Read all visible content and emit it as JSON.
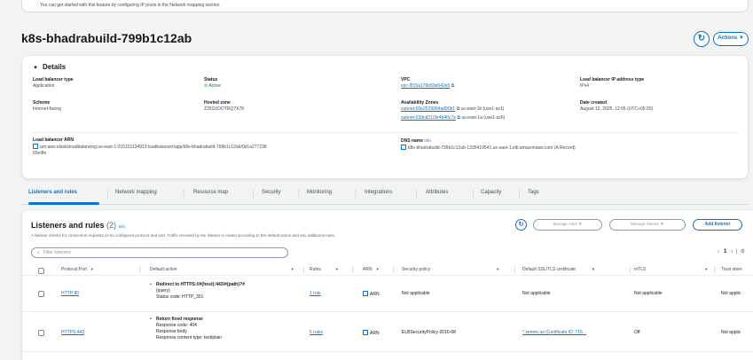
{
  "banner": {
    "text": "You can get started with this feature by configuring IP pools in the Network mapping section."
  },
  "header": {
    "title": "k8s-bhadrabuild-799b1c12ab",
    "actions_label": "Actions ▼"
  },
  "details": {
    "heading": "Details",
    "lb_type": {
      "label": "Load balancer type",
      "value": "Application"
    },
    "status": {
      "label": "Status",
      "value": "Active"
    },
    "vpc": {
      "label": "VPC",
      "value": "vpc-0f15a176b59e542e5"
    },
    "ip_type": {
      "label": "Load balancer IP address type",
      "value": "IPv4"
    },
    "scheme": {
      "label": "Scheme",
      "value": "Internet-facing"
    },
    "hosted_zone": {
      "label": "Hosted zone",
      "value": "Z35SXDOTRQ7X7K"
    },
    "az": {
      "label": "Availability Zones",
      "zones": [
        {
          "subnet": "subnet-00e2529994ad90b1",
          "zone": "us-east-1b (use1-az1)"
        },
        {
          "subnet": "subnet-02dcd212fe4b40c7e",
          "zone": "us-east-1a (use1-az6)"
        }
      ]
    },
    "date_created": {
      "label": "Date created",
      "value": "August 12, 2025, 12:05 (UTC+05:30)"
    },
    "arn": {
      "label": "Load balancer ARN",
      "value": "arn:aws:elasticloadbalancing:us-east-1:015101134913:loadbalancer/app/k8s-bhadrabuild-799b1c12ab/0d1a277238",
      "value2": "60e9fe"
    },
    "dns": {
      "label": "DNS name",
      "info": "Info",
      "value": "k8s-bhadrabuild-799b1c12ab-1335419541.us-east-1.elb.amazonaws.com (A Record)"
    }
  },
  "tabs": [
    "Listeners and rules",
    "Network mapping",
    "Resource map",
    "Security",
    "Monitoring",
    "Integrations",
    "Attributes",
    "Capacity",
    "Tags"
  ],
  "listeners": {
    "title": "Listeners and rules",
    "count": "(2)",
    "info": "Info",
    "description": "A listener checks for connection requests on its configured protocol and port. Traffic received by the listener is routed according to the default action and any additional rules.",
    "manage_rules": "Manage rules ▼",
    "manage_listener": "Manage listener ▼",
    "add_listener": "Add listener",
    "filter_placeholder": "Filter listeners",
    "page": "1",
    "columns": [
      "Protocol:Port",
      "Default action",
      "Rules",
      "ARN",
      "Security policy",
      "Default SSL/TLS certificate",
      "mTLS",
      "Trust store"
    ],
    "rows": [
      {
        "protocol": "HTTP:80",
        "action_title": "Redirect to HTTPS://#{host}:443/#{path}?#",
        "action_lines": [
          "{query}",
          "Status code: HTTP_301"
        ],
        "rules": "1 rule",
        "arn": "ARN",
        "policy": "Not applicable",
        "cert": "Not applicable",
        "mtls": "Not applicable",
        "trust": "Not applic"
      },
      {
        "protocol": "HTTPS:443",
        "action_title": "Return fixed response",
        "action_lines": [
          "Response code: 404",
          "Response body",
          "Response content type: text/plain"
        ],
        "rules": "5 rules",
        "arn": "ARN",
        "policy": "ELBSecurityPolicy-2016-08",
        "cert": "*.senmc.us (Certificate ID: 716...",
        "mtls": "Off",
        "trust": "Not applic"
      }
    ]
  }
}
